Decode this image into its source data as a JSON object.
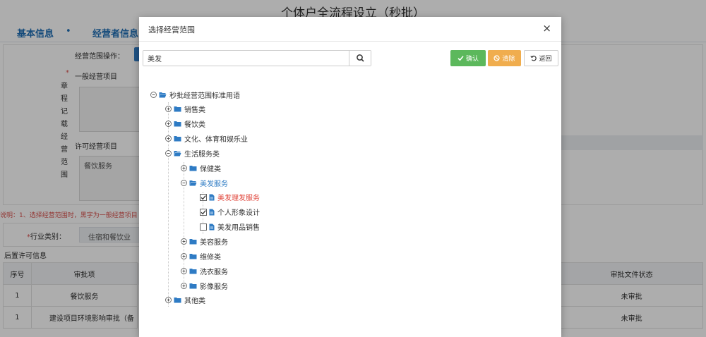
{
  "page": {
    "title": "个体户全流程设立（秒批）",
    "steps": [
      "基本信息",
      "经营者信息"
    ]
  },
  "form": {
    "scope_operation_label": "经营范围操作：",
    "general_label": "一般经营项目",
    "vertical_label": [
      "章",
      "程",
      "记",
      "载",
      "经",
      "营",
      "范",
      "围"
    ],
    "permit_label": "许可经营项目",
    "permit_value": "餐饮服务",
    "note": "说明：1、选择经营范围时，黑字为一般经营项目",
    "industry_label": "行业类别：",
    "industry_value": "住宿和餐饮业",
    "post_permit_title": "后置许可信息"
  },
  "table": {
    "headers": [
      "序号",
      "审批项",
      "审批文件状态"
    ],
    "rows": [
      {
        "index": "1",
        "item": "餐饮服务",
        "status": "未审批"
      },
      {
        "index": "1",
        "item": "建设项目环境影响审批（备",
        "status": "未审批"
      }
    ]
  },
  "modal": {
    "title": "选择经营范围",
    "close": "×",
    "search": {
      "value": "美发",
      "placeholder": ""
    },
    "buttons": {
      "confirm": "确认",
      "clear": "清除",
      "back": "返回"
    },
    "colors": {
      "confirm": "#5cb85c",
      "clear": "#f0ad4e",
      "folder": "#2e7bc4",
      "highlight": "#e0443a"
    },
    "tree": [
      {
        "label": "秒批经营范围标准用语",
        "level": 0,
        "expanded": true,
        "folder": true
      },
      {
        "label": "销售类",
        "level": 1,
        "expanded": false,
        "folder": true
      },
      {
        "label": "餐饮类",
        "level": 1,
        "expanded": false,
        "folder": true
      },
      {
        "label": "文化、体育和娱乐业",
        "level": 1,
        "expanded": false,
        "folder": true
      },
      {
        "label": "生活服务类",
        "level": 1,
        "expanded": true,
        "folder": true
      },
      {
        "label": "保健类",
        "level": 2,
        "expanded": false,
        "folder": true
      },
      {
        "label": "美发服务",
        "level": 2,
        "expanded": true,
        "folder": true,
        "highlight": true
      },
      {
        "label": "美发理发服务",
        "level": 3,
        "leaf": true,
        "checked": true,
        "red": true
      },
      {
        "label": "个人形象设计",
        "level": 3,
        "leaf": true,
        "checked": true
      },
      {
        "label": "美发用品销售",
        "level": 3,
        "leaf": true,
        "checked": false
      },
      {
        "label": "美容服务",
        "level": 2,
        "expanded": false,
        "folder": true
      },
      {
        "label": "维修类",
        "level": 2,
        "expanded": false,
        "folder": true
      },
      {
        "label": "洗衣服务",
        "level": 2,
        "expanded": false,
        "folder": true
      },
      {
        "label": "影像服务",
        "level": 2,
        "expanded": false,
        "folder": true
      },
      {
        "label": "其他类",
        "level": 1,
        "expanded": false,
        "folder": true
      }
    ]
  }
}
